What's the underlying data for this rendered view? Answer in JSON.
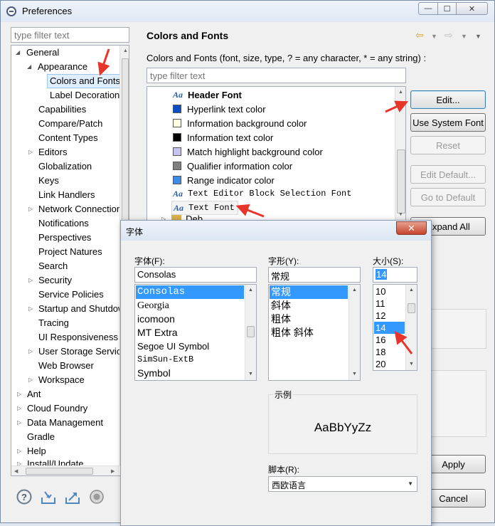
{
  "window": {
    "title": "Preferences"
  },
  "left": {
    "filter_placeholder": "type filter text",
    "tree": [
      "General",
      "Appearance",
      "Colors and Fonts",
      "Label Decorations",
      "Capabilities",
      "Compare/Patch",
      "Content Types",
      "Editors",
      "Globalization",
      "Keys",
      "Link Handlers",
      "Network Connections",
      "Notifications",
      "Perspectives",
      "Project Natures",
      "Search",
      "Security",
      "Service Policies",
      "Startup and Shutdown",
      "Tracing",
      "UI Responsiveness",
      "User Storage Service",
      "Web Browser",
      "Workspace",
      "Ant",
      "Cloud Foundry",
      "Data Management",
      "Gradle",
      "Help",
      "Install/Update"
    ]
  },
  "right": {
    "title": "Colors and Fonts",
    "description": "Colors and Fonts (font, size, type, ? = any character, * = any string) :",
    "filter_placeholder": "type filter text",
    "items": [
      {
        "label": "Header Font",
        "kind": "font"
      },
      {
        "label": "Hyperlink text color",
        "kind": "color",
        "color": "#0a4fc7"
      },
      {
        "label": "Information background color",
        "kind": "color",
        "color": "#ffffe1"
      },
      {
        "label": "Information text color",
        "kind": "color",
        "color": "#000000"
      },
      {
        "label": "Match highlight background color",
        "kind": "color",
        "color": "#c7c3f0"
      },
      {
        "label": "Qualifier information color",
        "kind": "color",
        "color": "#7f7f7f"
      },
      {
        "label": "Range indicator color",
        "kind": "color",
        "color": "#3b8ce9"
      },
      {
        "label": "Text Editor Block Selection Font",
        "kind": "font"
      },
      {
        "label": "Text Font",
        "kind": "font"
      }
    ],
    "partial_row": "Deb",
    "buttons": {
      "edit": "Edit...",
      "use_system_font": "Use System Font",
      "reset": "Reset",
      "edit_default": "Edit Default...",
      "go_to_default": "Go to Default",
      "expand_all": "Expand All",
      "expand_all_visible": "pand All",
      "apply": "Apply",
      "cancel": "Cancel",
      "cancel_visible": "ancel"
    }
  },
  "dialog": {
    "title": "字体",
    "font_label": "字体(F):",
    "style_label": "字形(Y):",
    "size_label": "大小(S):",
    "font_value": "Consolas",
    "style_value": "常规",
    "size_value": "14",
    "fonts": [
      "Consolas",
      "Georgia",
      "icomoon",
      "MT Extra",
      "Segoe UI Symbol",
      "SimSun-ExtB",
      "Symbol"
    ],
    "styles": [
      "常规",
      "斜体",
      "粗体",
      "粗体 斜体"
    ],
    "sizes": [
      "10",
      "11",
      "12",
      "14",
      "16",
      "18",
      "20"
    ],
    "sample_label": "示例",
    "sample_text": "AaBbYyZz",
    "script_label": "脚本(R):",
    "script_value": "西欧语言"
  }
}
